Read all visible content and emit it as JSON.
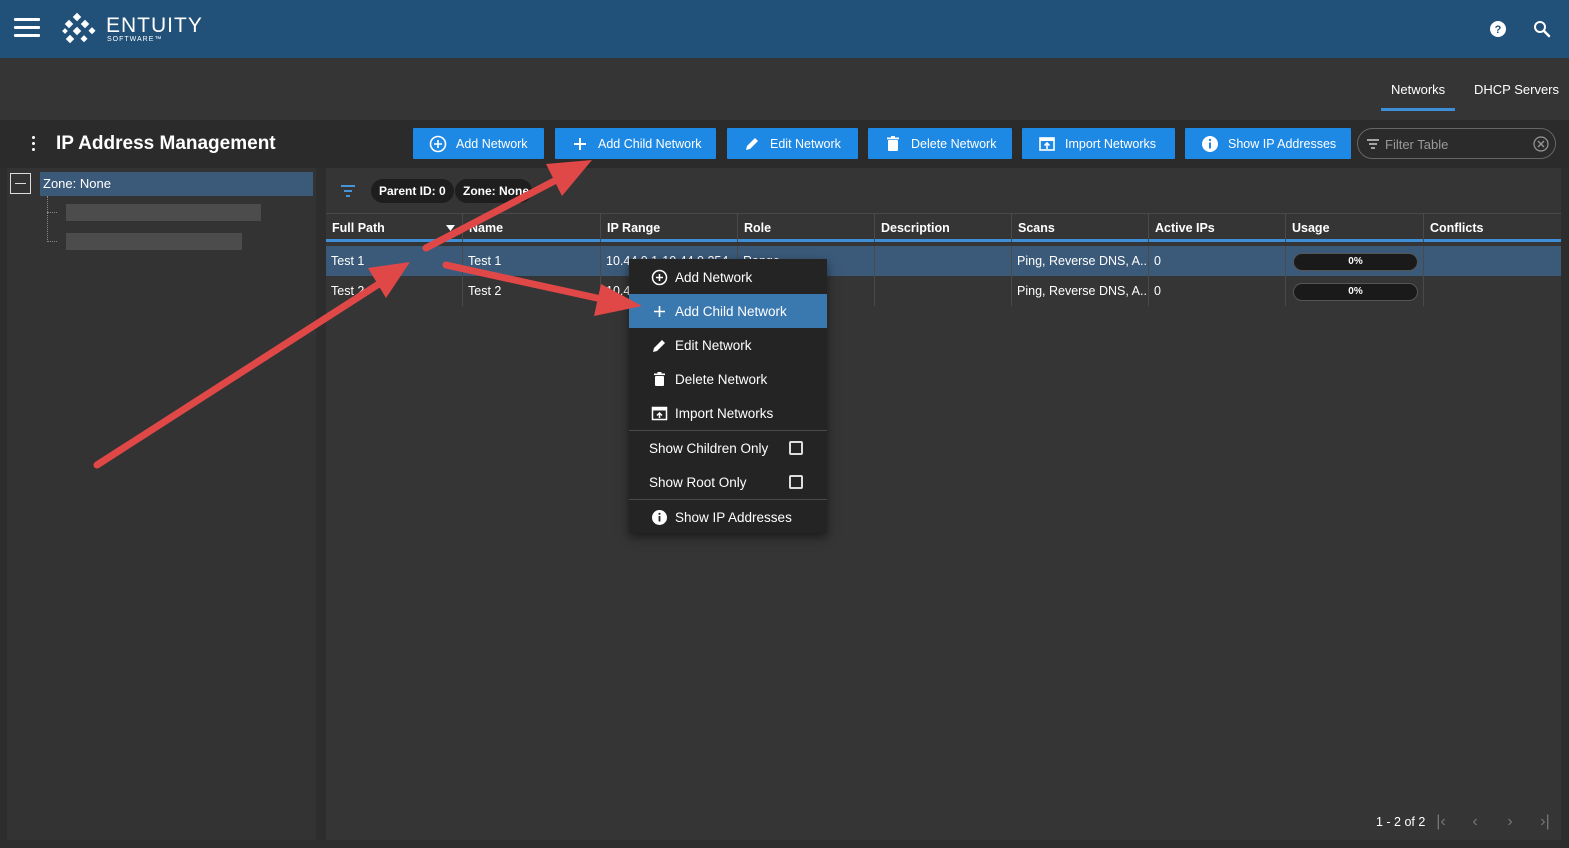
{
  "brand": {
    "name": "ENTUITY",
    "sub": "SOFTWARE™"
  },
  "subnav": {
    "tabs": [
      {
        "label": "Networks"
      },
      {
        "label": "DHCP Servers"
      }
    ]
  },
  "page": {
    "title": "IP Address Management"
  },
  "toolbar": {
    "add_network": "Add Network",
    "add_child": "Add Child Network",
    "edit": "Edit Network",
    "delete": "Delete Network",
    "import": "Import Networks",
    "show_ips": "Show IP Addresses",
    "filter_placeholder": "Filter Table"
  },
  "tree": {
    "root": "Zone: None"
  },
  "filters": {
    "chips": [
      "Parent ID: 0",
      "Zone: None"
    ]
  },
  "table": {
    "columns": [
      "Full Path",
      "Name",
      "IP Range",
      "Role",
      "Description",
      "Scans",
      "Active IPs",
      "Usage",
      "Conflicts"
    ],
    "rows": [
      {
        "full_path": "Test 1",
        "name": "Test 1",
        "ip_range": "10.44.0.1-10.44.0.254",
        "role": "Range",
        "description": "",
        "scans": "Ping, Reverse DNS, A...",
        "active_ips": "0",
        "usage": "0%",
        "conflicts": ""
      },
      {
        "full_path": "Test 2",
        "name": "Test 2",
        "ip_range": "10.4",
        "role": "",
        "description": "",
        "scans": "Ping, Reverse DNS, A...",
        "active_ips": "0",
        "usage": "0%",
        "conflicts": ""
      }
    ]
  },
  "pagination": {
    "text": "1 - 2 of 2"
  },
  "context_menu": {
    "items": [
      "Add Network",
      "Add Child Network",
      "Edit Network",
      "Delete Network",
      "Import Networks"
    ],
    "toggles": [
      "Show Children Only",
      "Show Root Only"
    ],
    "show_ips": "Show IP Addresses"
  },
  "colors": {
    "topbar": "#215078",
    "accent": "#1e88e5",
    "annotation_arrow": "#e04848"
  }
}
